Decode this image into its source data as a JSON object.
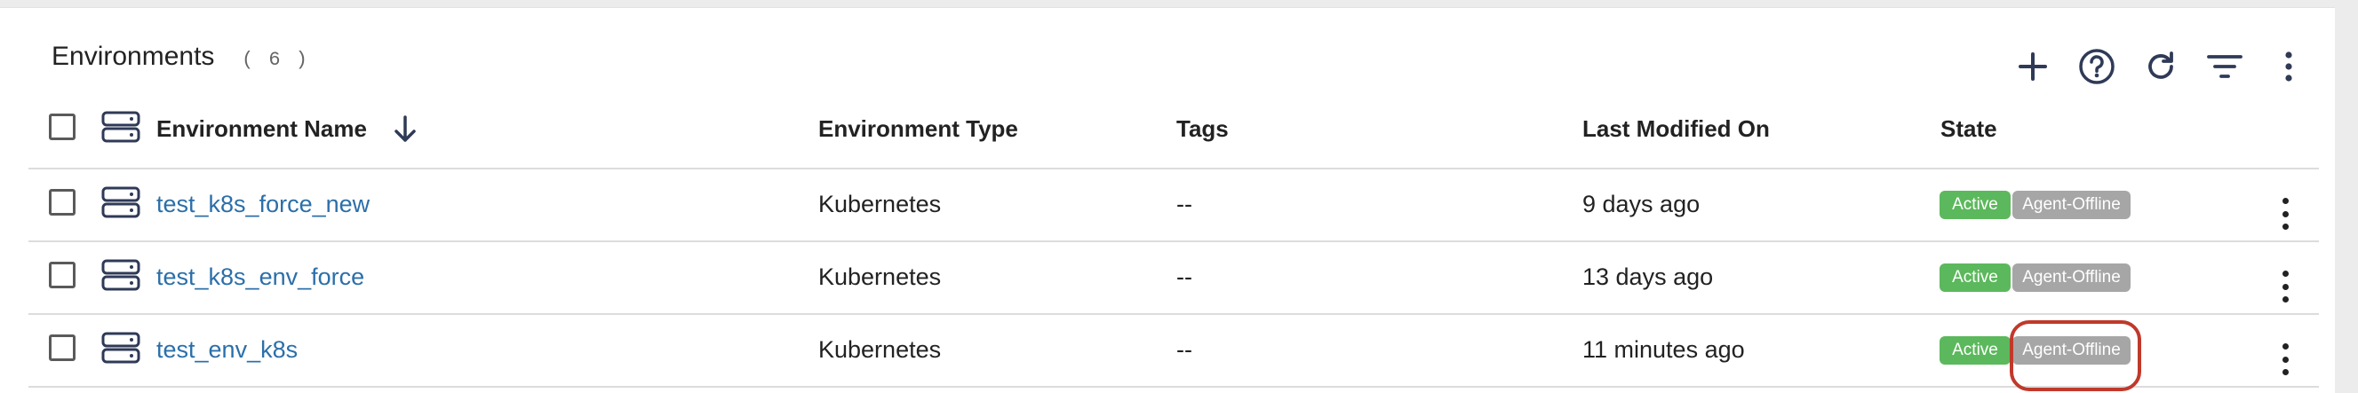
{
  "header": {
    "title": "Environments",
    "count": "( 6 )"
  },
  "toolbar": {
    "icons": [
      "plus-icon",
      "help-icon",
      "refresh-icon",
      "filter-icon",
      "more-vertical-icon"
    ]
  },
  "table": {
    "columns": {
      "name": "Environment Name",
      "type": "Environment Type",
      "tags": "Tags",
      "modified": "Last Modified On",
      "state": "State"
    },
    "sort": "descending",
    "rows": [
      {
        "name": "test_k8s_force_new",
        "type": "Kubernetes",
        "tags": "--",
        "modified": "9 days ago",
        "state": "Active",
        "agent": "Agent-Offline"
      },
      {
        "name": "test_k8s_env_force",
        "type": "Kubernetes",
        "tags": "--",
        "modified": "13 days ago",
        "state": "Active",
        "agent": "Agent-Offline"
      },
      {
        "name": "test_env_k8s",
        "type": "Kubernetes",
        "tags": "--",
        "modified": "11 minutes ago",
        "state": "Active",
        "agent": "Agent-Offline"
      }
    ]
  },
  "colors": {
    "link": "#2b6fa9",
    "active_badge": "#5cb85c",
    "offline_badge": "#a6a6a6",
    "highlight": "#c0392b"
  }
}
